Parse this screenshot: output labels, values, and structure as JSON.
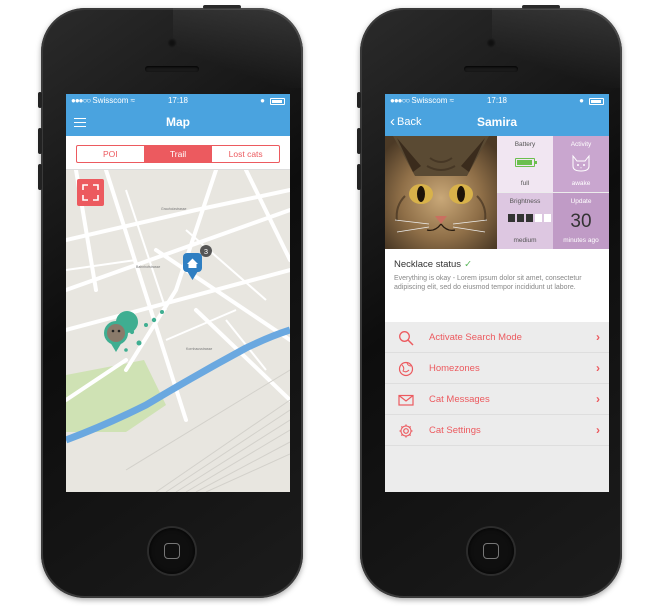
{
  "colors": {
    "nav_blue": "#4aa3df",
    "accent_red": "#ec5a5f",
    "tile_light": "#f1e6f2",
    "tile_purple": "#c9a6cf"
  },
  "left_phone": {
    "status_bar": {
      "signal": "●●●○○",
      "carrier": "Swisscom",
      "time": "17:18"
    },
    "nav": {
      "title": "Map",
      "menu_icon": "hamburger-icon"
    },
    "segments": [
      "POI",
      "Trail",
      "Lost cats"
    ],
    "active_segment": "Trail",
    "expand_icon": "expand-icon",
    "map": {
      "marker_count": "3",
      "street_labels": [
        "Grauholzstrasse",
        "Bahnhofstrasse",
        "Kornhausstrasse"
      ]
    }
  },
  "right_phone": {
    "status_bar": {
      "signal": "●●●○○",
      "carrier": "Swisscom",
      "time": "17:18"
    },
    "nav": {
      "back_label": "Back",
      "title": "Samira"
    },
    "tiles": {
      "battery": {
        "label": "Battery",
        "sub": "full"
      },
      "activity": {
        "label": "Activity",
        "sub": "awake"
      },
      "brightness": {
        "label": "Brightness",
        "sub": "medium",
        "level": 3,
        "max": 5
      },
      "update": {
        "label": "Update",
        "value": "30",
        "sub": "minutes ago"
      }
    },
    "necklace": {
      "title": "Necklace status",
      "description": "Everything is okay - Lorem ipsum dolor sit amet, consectetur adipiscing elit, sed do eiusmod tempor incididunt ut labore."
    },
    "menu": [
      {
        "label": "Activate Search Mode",
        "icon": "search-icon"
      },
      {
        "label": "Homezones",
        "icon": "globe-icon"
      },
      {
        "label": "Cat Messages",
        "icon": "envelope-icon"
      },
      {
        "label": "Cat Settings",
        "icon": "gear-icon"
      }
    ]
  }
}
